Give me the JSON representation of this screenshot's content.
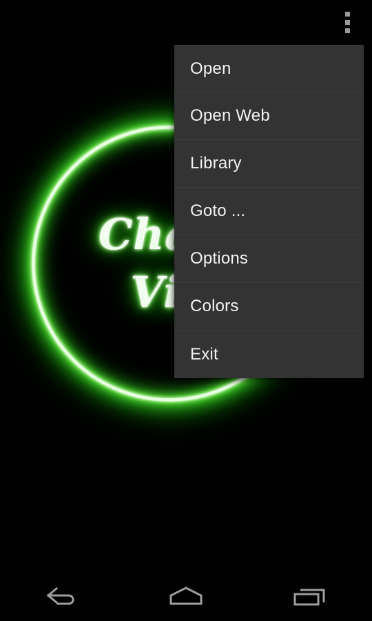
{
  "app": {
    "splash": {
      "logo_line_1": "Chalk",
      "logo_line_2": "Vie",
      "logo_color": "#5fdb3b",
      "background_color": "#000000"
    }
  },
  "actionbar": {
    "overflow_icon": "overflow-menu-icon",
    "overflow_label": "More options"
  },
  "menu": {
    "background_color": "#333333",
    "divider_color": "#3d3d3d",
    "text_color": "#f2f2f2",
    "items": [
      {
        "label": "Open",
        "name": "menu-item-open"
      },
      {
        "label": "Open Web",
        "name": "menu-item-open-web"
      },
      {
        "label": "Library",
        "name": "menu-item-library"
      },
      {
        "label": "Goto ...",
        "name": "menu-item-goto"
      },
      {
        "label": "Options",
        "name": "menu-item-options"
      },
      {
        "label": "Colors",
        "name": "menu-item-colors"
      },
      {
        "label": "Exit",
        "name": "menu-item-exit"
      }
    ]
  },
  "navbar": {
    "background_color": "#000000",
    "icon_color": "#9e9e9e",
    "buttons": [
      {
        "label": "Back",
        "icon": "back-arrow-icon"
      },
      {
        "label": "Home",
        "icon": "home-icon"
      },
      {
        "label": "Recents",
        "icon": "recents-icon"
      }
    ]
  }
}
